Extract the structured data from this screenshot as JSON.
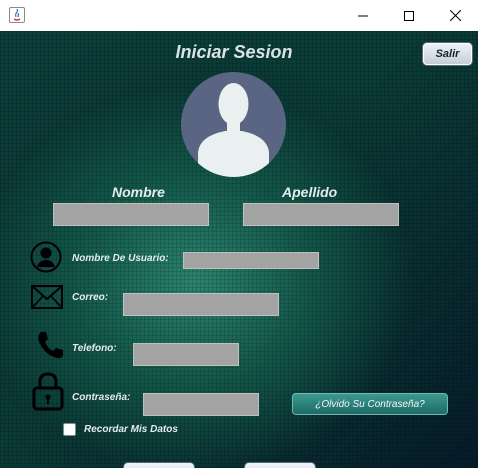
{
  "window": {
    "title": "",
    "controls": {
      "minimize_icon": "minimize-icon",
      "maximize_icon": "maximize-icon",
      "close_icon": "close-icon"
    }
  },
  "header": {
    "title": "Iniciar Sesion",
    "exit_label": "Salir"
  },
  "avatar": {
    "icon": "user-silhouette-icon"
  },
  "form": {
    "first_name_label": "Nombre",
    "first_name_value": "",
    "last_name_label": "Apellido",
    "last_name_value": "",
    "username_label": "Nombre De Usuario:",
    "username_value": "",
    "email_label": "Correo:",
    "email_value": "",
    "phone_label": "Telefono:",
    "phone_value": "",
    "password_label": "Contraseña:",
    "password_value": "",
    "forgot_label": "¿Olvido Su Contraseña?",
    "remember_label": "Recordar Mis Datos",
    "remember_checked": false
  },
  "icons": {
    "user": "user-circle-icon",
    "email": "envelope-icon",
    "phone": "phone-icon",
    "password": "padlock-icon"
  },
  "colors": {
    "background": "#0b3b35",
    "input_fill": "#a3a3a3",
    "avatar_fill": "#5a6584",
    "forgot_button": "#2a807a",
    "label_text": "#e4ecec"
  }
}
